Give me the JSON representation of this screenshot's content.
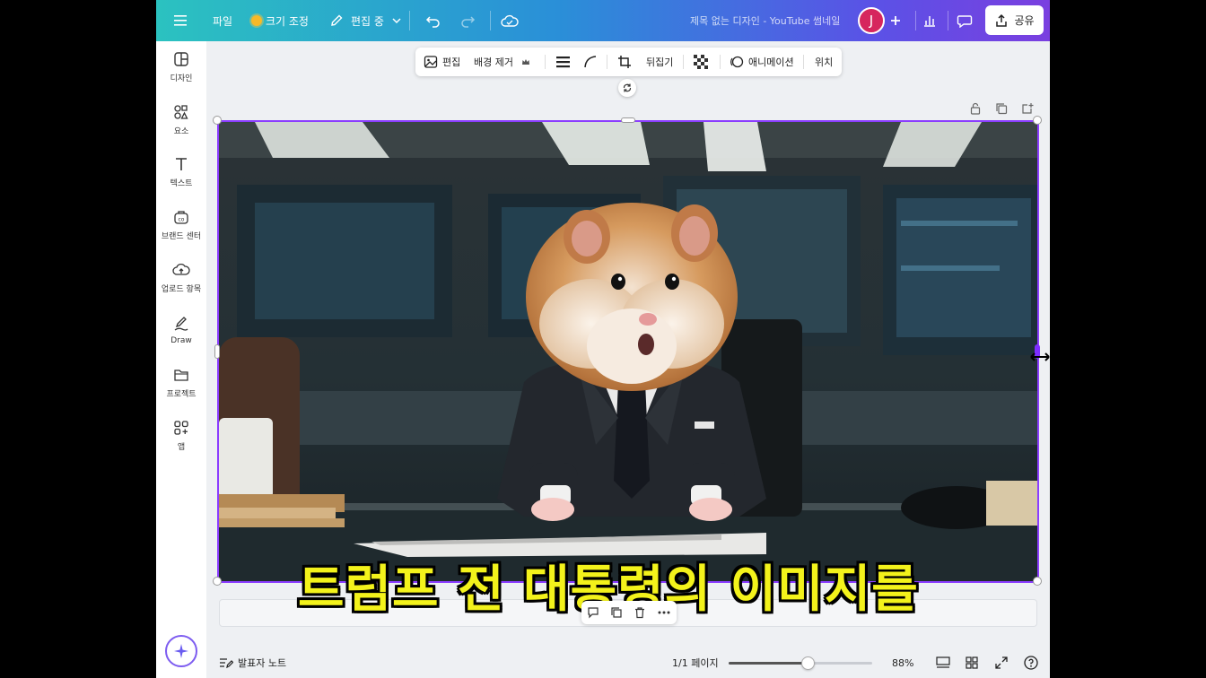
{
  "topbar": {
    "menu_icon": "hamburger-icon",
    "file_label": "파일",
    "resize_label": "크기 조정",
    "edit_mode_label": "편집 중",
    "doc_title": "제목 없는 디자인 - YouTube 썸네일",
    "avatar_initial": "J",
    "share_label": "공유"
  },
  "context_toolbar": {
    "edit_label": "편집",
    "bg_remove_label": "배경 제거",
    "flip_label": "뒤집기",
    "animation_label": "애니메이션",
    "position_label": "위치"
  },
  "sidebar": {
    "items": [
      {
        "label": "디자인",
        "icon": "layout-icon"
      },
      {
        "label": "요소",
        "icon": "shapes-icon"
      },
      {
        "label": "텍스트",
        "icon": "text-icon"
      },
      {
        "label": "브랜드 센터",
        "icon": "brand-icon"
      },
      {
        "label": "업로드 항목",
        "icon": "cloud-upload-icon"
      },
      {
        "label": "Draw",
        "icon": "pen-icon"
      },
      {
        "label": "프로젝트",
        "icon": "folder-icon"
      },
      {
        "label": "앱",
        "icon": "apps-icon"
      }
    ]
  },
  "canvas": {
    "subtitle": "트럼프 전 대통령의 이미지를"
  },
  "bottombar": {
    "notes_label": "발표자 노트",
    "page_indicator": "1/1 페이지",
    "zoom_value": "88%",
    "zoom_fraction": 0.55
  },
  "colors": {
    "accent": "#8b3dff",
    "subtitle_fill": "#f3f21b",
    "avatar_bg": "#d6265e"
  }
}
